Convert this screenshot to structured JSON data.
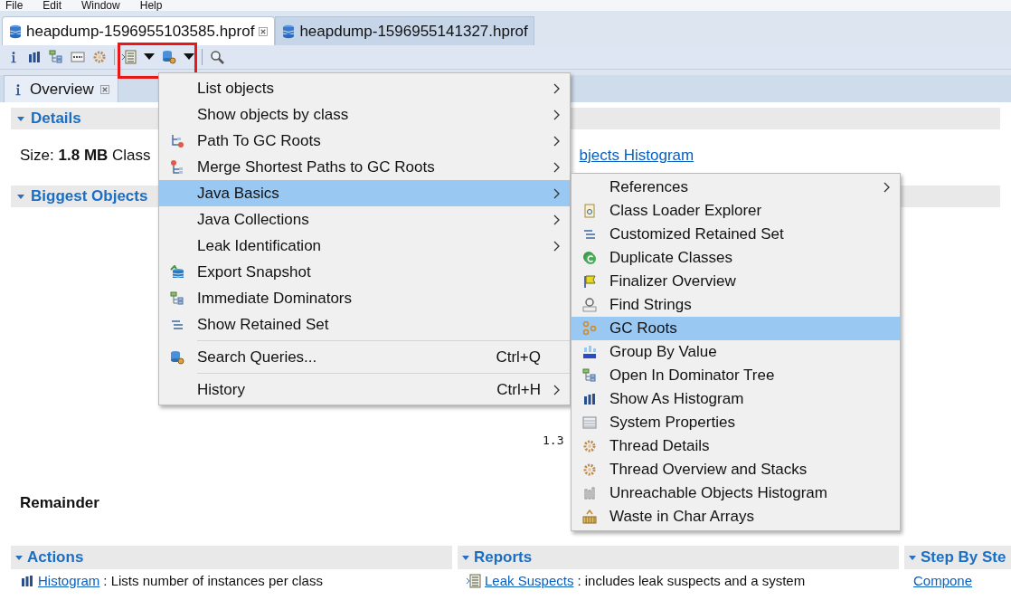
{
  "menubar": [
    "File",
    "Edit",
    "Window",
    "Help"
  ],
  "editor_tabs": [
    {
      "label": "heapdump-1596955103585.hprof",
      "selected": true,
      "closable": true
    },
    {
      "label": "heapdump-1596955141327.hprof",
      "selected": false,
      "closable": false
    }
  ],
  "view_tabs": [
    {
      "label": "Overview",
      "selected": true,
      "closable": true
    }
  ],
  "details": {
    "title": "Details",
    "expanded": true,
    "size_label": "Size:",
    "size_value": "1.8 MB",
    "rest": "Class",
    "link": "bjects Histogram"
  },
  "biggest_objects": {
    "title": "Biggest Objects",
    "expanded": true,
    "slice_label": "1.3",
    "remainder_label": "Remainder"
  },
  "panels": [
    {
      "title": "Actions",
      "expanded": true,
      "link": "Histogram",
      "text": ": Lists number of instances per class"
    },
    {
      "title": "Reports",
      "expanded": true,
      "link": "Leak Suspects",
      "text": ": includes leak suspects and a system"
    },
    {
      "title": "Step By Ste",
      "expanded": true,
      "link": "Compone"
    }
  ],
  "context_menu": {
    "items": [
      {
        "kind": "item",
        "label": "List objects",
        "submenu": true,
        "selected": false
      },
      {
        "kind": "item",
        "label": "Show objects by class",
        "submenu": true,
        "selected": false
      },
      {
        "kind": "item",
        "label": "Path To GC Roots",
        "submenu": true,
        "selected": false
      },
      {
        "kind": "item",
        "label": "Merge Shortest Paths to GC Roots",
        "submenu": true,
        "selected": false
      },
      {
        "kind": "item",
        "label": "Java Basics",
        "submenu": true,
        "selected": true
      },
      {
        "kind": "item",
        "label": "Java Collections",
        "submenu": true,
        "selected": false
      },
      {
        "kind": "item",
        "label": "Leak Identification",
        "submenu": true,
        "selected": false
      },
      {
        "kind": "item",
        "label": "Export Snapshot",
        "submenu": false,
        "selected": false
      },
      {
        "kind": "item",
        "label": "Immediate Dominators",
        "submenu": false,
        "selected": false
      },
      {
        "kind": "item",
        "label": "Show Retained Set",
        "submenu": false,
        "selected": false
      },
      {
        "kind": "separator"
      },
      {
        "kind": "item",
        "label": "Search Queries...",
        "shortcut": "Ctrl+Q",
        "submenu": false,
        "selected": false
      },
      {
        "kind": "separator"
      },
      {
        "kind": "item",
        "label": "History",
        "shortcut": "Ctrl+H",
        "submenu": true,
        "selected": false
      }
    ]
  },
  "submenu": {
    "items": [
      {
        "kind": "item",
        "label": "References",
        "submenu": true,
        "selected": false
      },
      {
        "kind": "item",
        "label": "Class Loader Explorer",
        "submenu": false,
        "selected": false
      },
      {
        "kind": "item",
        "label": "Customized Retained Set",
        "submenu": false,
        "selected": false
      },
      {
        "kind": "item",
        "label": "Duplicate Classes",
        "submenu": false,
        "selected": false
      },
      {
        "kind": "item",
        "label": "Finalizer Overview",
        "submenu": false,
        "selected": false
      },
      {
        "kind": "item",
        "label": "Find Strings",
        "submenu": false,
        "selected": false
      },
      {
        "kind": "item",
        "label": "GC Roots",
        "submenu": false,
        "selected": true
      },
      {
        "kind": "item",
        "label": "Group By Value",
        "submenu": false,
        "selected": false
      },
      {
        "kind": "item",
        "label": "Open In Dominator Tree",
        "submenu": false,
        "selected": false
      },
      {
        "kind": "item",
        "label": "Show As Histogram",
        "submenu": false,
        "selected": false
      },
      {
        "kind": "item",
        "label": "System Properties",
        "submenu": false,
        "selected": false
      },
      {
        "kind": "item",
        "label": "Thread Details",
        "submenu": false,
        "selected": false
      },
      {
        "kind": "item",
        "label": "Thread Overview and Stacks",
        "submenu": false,
        "selected": false
      },
      {
        "kind": "item",
        "label": "Unreachable Objects Histogram",
        "submenu": false,
        "selected": false
      },
      {
        "kind": "item",
        "label": "Waste in Char Arrays",
        "submenu": false,
        "selected": false
      }
    ]
  }
}
